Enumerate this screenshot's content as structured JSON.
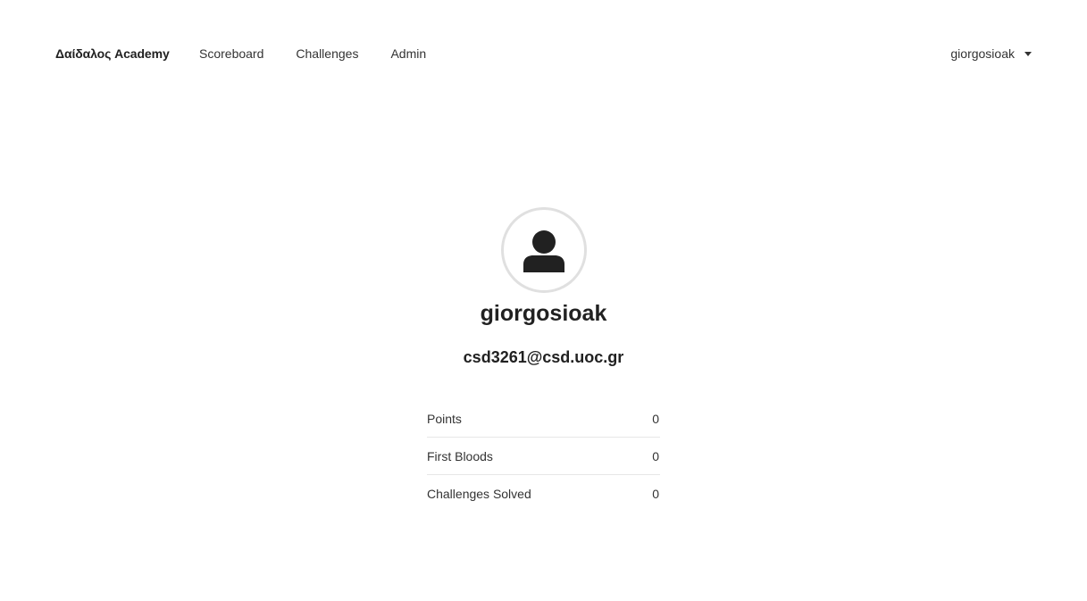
{
  "navbar": {
    "brand": "Δαίδαλος Academy",
    "links": [
      {
        "label": "Scoreboard"
      },
      {
        "label": "Challenges"
      },
      {
        "label": "Admin"
      }
    ],
    "user_menu_label": "giorgosioak"
  },
  "profile": {
    "avatar_icon": "user-icon",
    "username": "giorgosioak",
    "email": "csd3261@csd.uoc.gr",
    "stats": [
      {
        "label": "Points",
        "value": "0"
      },
      {
        "label": "First Bloods",
        "value": "0"
      },
      {
        "label": "Challenges Solved",
        "value": "0"
      }
    ]
  },
  "colors": {
    "text": "#212121",
    "divider": "#e6e6e6",
    "avatar_ring": "#e0e0e0"
  }
}
